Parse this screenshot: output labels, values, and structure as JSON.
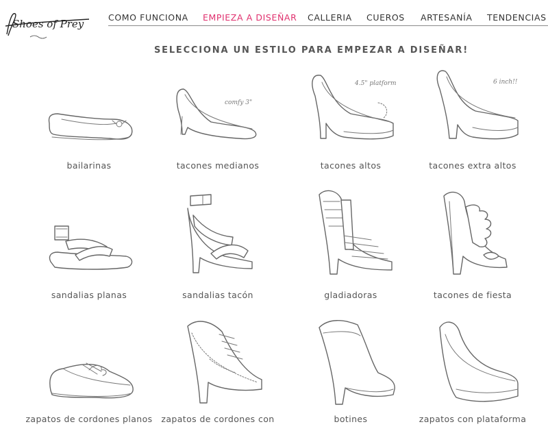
{
  "brand": {
    "name": "Shoes of Prey"
  },
  "nav": {
    "items": [
      {
        "label": "COMO FUNCIONA",
        "active": false
      },
      {
        "label": "EMPIEZA A DISEÑAR",
        "active": true
      },
      {
        "label": "CALLERIA",
        "active": false
      },
      {
        "label": "CUEROS",
        "active": false
      },
      {
        "label": "ARTESANÍA",
        "active": false
      },
      {
        "label": "TENDENCIAS",
        "active": false
      }
    ],
    "active_color": "#e0306e"
  },
  "heading": "SELECCIONA UN ESTILO PARA EMPEZAR A DISEÑAR!",
  "styles": [
    {
      "label": "bailarinas",
      "icon": "ballet-flat-icon"
    },
    {
      "label": "tacones medianos",
      "icon": "mid-heel-icon",
      "note": "comfy 3\""
    },
    {
      "label": "tacones altos",
      "icon": "high-heel-icon",
      "note": "4.5\" platform"
    },
    {
      "label": "tacones extra altos",
      "icon": "extra-high-heel-icon",
      "note": "6 inch!!"
    },
    {
      "label": "sandalias planas",
      "icon": "flat-sandal-icon"
    },
    {
      "label": "sandalias tacón",
      "icon": "heeled-sandal-icon"
    },
    {
      "label": "gladiadoras",
      "icon": "gladiator-icon"
    },
    {
      "label": "tacones de fiesta",
      "icon": "party-heel-icon"
    },
    {
      "label": "zapatos de cordones planos",
      "icon": "flat-lace-up-icon"
    },
    {
      "label": "zapatos de cordones con",
      "icon": "heeled-lace-up-icon"
    },
    {
      "label": "botines",
      "icon": "bootie-icon"
    },
    {
      "label": "zapatos con plataforma",
      "icon": "platform-wedge-icon"
    }
  ]
}
